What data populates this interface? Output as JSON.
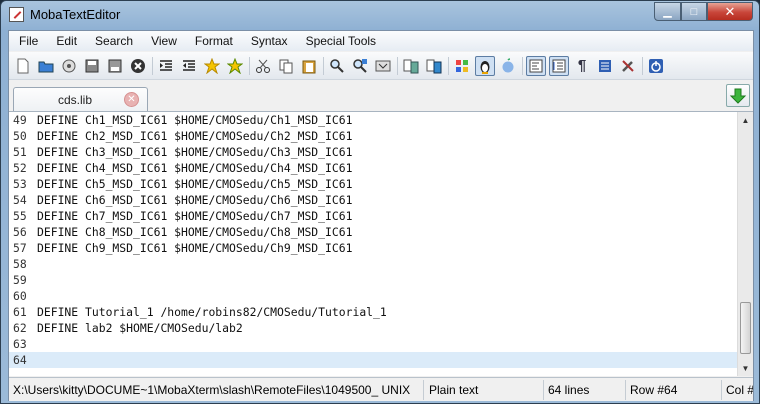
{
  "window": {
    "title": "MobaTextEditor"
  },
  "window_controls": {
    "minimize": "▁",
    "maximize": "□",
    "close": "✕"
  },
  "menu": [
    "File",
    "Edit",
    "Search",
    "View",
    "Format",
    "Syntax",
    "Special Tools"
  ],
  "toolbar_icons": [
    "new-file-icon",
    "open-folder-icon",
    "reload-icon",
    "save-icon",
    "save-as-icon",
    "close-file-icon",
    "indent-icon",
    "unindent-icon",
    "bookmark-star-icon",
    "bookmark-next-icon",
    "cut-icon",
    "copy-icon",
    "paste-icon",
    "find-icon",
    "find-replace-icon",
    "find-next-icon",
    "compare-icon",
    "sync-icon",
    "windows-format-icon",
    "linux-format-icon",
    "mac-format-icon",
    "word-wrap-icon",
    "line-numbers-icon",
    "show-whitespace-icon",
    "document-list-icon",
    "tools-icon",
    "power-icon"
  ],
  "tab": {
    "label": "cds.lib",
    "close": "✕"
  },
  "editor": {
    "lines": [
      {
        "num": "49",
        "text": "DEFINE Ch1_MSD_IC61 $HOME/CMOSedu/Ch1_MSD_IC61"
      },
      {
        "num": "50",
        "text": "DEFINE Ch2_MSD_IC61 $HOME/CMOSedu/Ch2_MSD_IC61"
      },
      {
        "num": "51",
        "text": "DEFINE Ch3_MSD_IC61 $HOME/CMOSedu/Ch3_MSD_IC61"
      },
      {
        "num": "52",
        "text": "DEFINE Ch4_MSD_IC61 $HOME/CMOSedu/Ch4_MSD_IC61"
      },
      {
        "num": "53",
        "text": "DEFINE Ch5_MSD_IC61 $HOME/CMOSedu/Ch5_MSD_IC61"
      },
      {
        "num": "54",
        "text": "DEFINE Ch6_MSD_IC61 $HOME/CMOSedu/Ch6_MSD_IC61"
      },
      {
        "num": "55",
        "text": "DEFINE Ch7_MSD_IC61 $HOME/CMOSedu/Ch7_MSD_IC61"
      },
      {
        "num": "56",
        "text": "DEFINE Ch8_MSD_IC61 $HOME/CMOSedu/Ch8_MSD_IC61"
      },
      {
        "num": "57",
        "text": "DEFINE Ch9_MSD_IC61 $HOME/CMOSedu/Ch9_MSD_IC61"
      },
      {
        "num": "58",
        "text": ""
      },
      {
        "num": "59",
        "text": ""
      },
      {
        "num": "60",
        "text": ""
      },
      {
        "num": "61",
        "text": "DEFINE Tutorial_1 /home/robins82/CMOSedu/Tutorial_1"
      },
      {
        "num": "62",
        "text": "DEFINE lab2 $HOME/CMOSedu/lab2"
      },
      {
        "num": "63",
        "text": ""
      },
      {
        "num": "64",
        "text": ""
      }
    ],
    "current_line": "64"
  },
  "status": {
    "path": "X:\\Users\\kitty\\DOCUME~1\\MobaXterm\\slash\\RemoteFiles\\1049500_",
    "eol": "UNIX",
    "filetype": "Plain text",
    "line_count": "64 lines",
    "row": "Row #64",
    "col": "Col #"
  }
}
